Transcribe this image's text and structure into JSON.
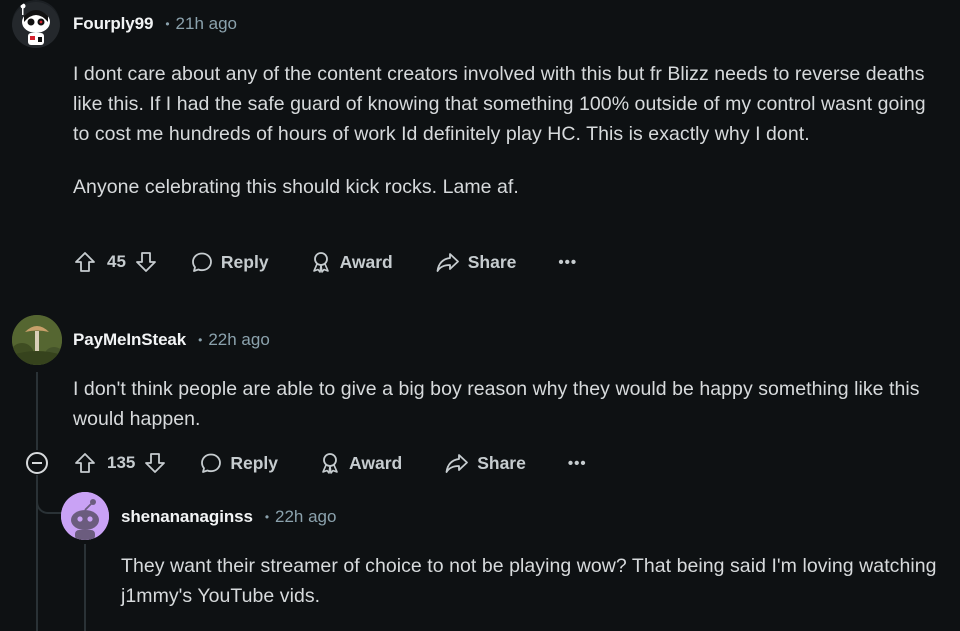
{
  "comments": [
    {
      "username": "Fourply99",
      "time": "21h ago",
      "paragraphs": [
        "I dont care about any of the content creators involved with this but fr Blizz needs to reverse deaths like this. If I had the safe guard of knowing that something 100% outside of my control wasnt going to cost me hundreds of hours of work Id definitely play HC. This is exactly why I dont.",
        "Anyone celebrating this should kick rocks. Lame af."
      ],
      "votes": "45",
      "reply_label": "Reply",
      "award_label": "Award",
      "share_label": "Share",
      "more_label": "•••"
    },
    {
      "username": "PayMeInSteak",
      "time": "22h ago",
      "paragraphs": [
        "I don't think people are able to give a big boy reason why they would be happy something like this would happen."
      ],
      "votes": "135",
      "reply_label": "Reply",
      "award_label": "Award",
      "share_label": "Share",
      "more_label": "•••"
    },
    {
      "username": "shenananaginss",
      "time": "22h ago",
      "paragraphs": [
        "They want their streamer of choice to not be playing wow? That being said I'm loving watching j1mmy's YouTube vids."
      ]
    }
  ],
  "separator": "•",
  "colors": {
    "background": "#0e1113",
    "text": "#d7dadc",
    "meta": "#8ba2ad",
    "thread_line": "#2a3236",
    "avatar_purple": "#c9a2f5"
  },
  "icons": [
    "upvote-icon",
    "downvote-icon",
    "reply-icon",
    "award-icon",
    "share-icon",
    "more-icon",
    "collapse-icon"
  ]
}
